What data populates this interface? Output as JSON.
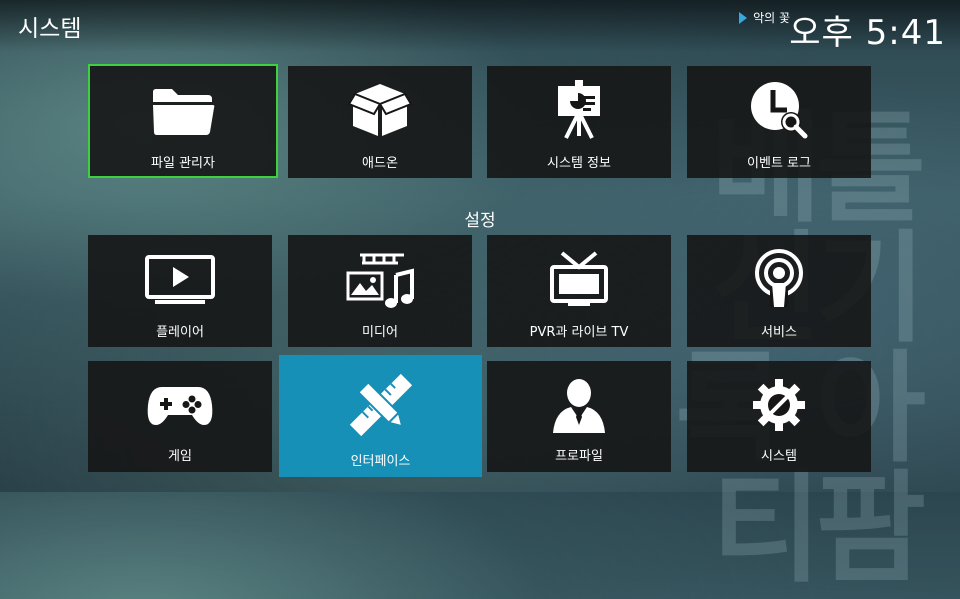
{
  "header": {
    "title": "시스템",
    "now_playing": "악의 꽃",
    "clock": "오후 5:41"
  },
  "background": {
    "watermark": "배틀 신기록 아티팜"
  },
  "top_tiles": [
    {
      "label": "파일 관리자",
      "icon": "folder-icon",
      "focused": true
    },
    {
      "label": "애드온",
      "icon": "addon-box-icon"
    },
    {
      "label": "시스템 정보",
      "icon": "presentation-board-icon"
    },
    {
      "label": "이벤트 로그",
      "icon": "clock-search-icon"
    }
  ],
  "settings_section": {
    "title": "설정",
    "tiles": [
      {
        "label": "플레이어",
        "icon": "monitor-play-icon"
      },
      {
        "label": "미디어",
        "icon": "media-library-icon"
      },
      {
        "label": "PVR과 라이브 TV",
        "icon": "tv-antenna-icon"
      },
      {
        "label": "서비스",
        "icon": "podcast-broadcast-icon"
      },
      {
        "label": "게임",
        "icon": "gamepad-icon"
      },
      {
        "label": "인터페이스",
        "icon": "pencil-ruler-icon",
        "selected": true
      },
      {
        "label": "프로파일",
        "icon": "user-profile-icon"
      },
      {
        "label": "시스템",
        "icon": "gear-tools-icon"
      }
    ]
  },
  "colors": {
    "focus_border": "#3dd13d",
    "selected_tile": "#1690b6",
    "accent": "#3aa7e0"
  }
}
